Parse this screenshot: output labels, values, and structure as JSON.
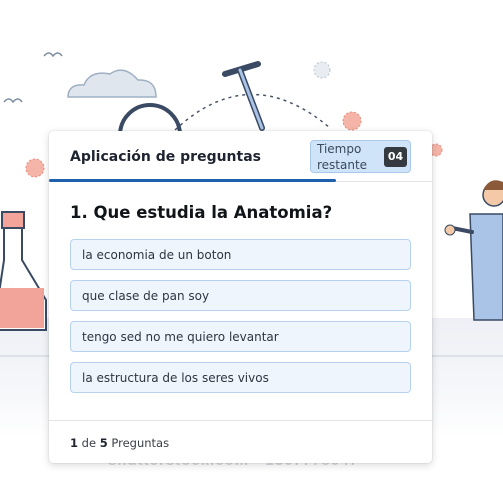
{
  "app": {
    "title": "Aplicación de preguntas",
    "timer_label": "Tiempo restante",
    "timer_value": "04",
    "time_progress_fraction": 0.75
  },
  "quiz": {
    "question": "1. Que estudia la Anatomia?",
    "options": [
      "la economia de un boton",
      "que clase de pan soy",
      "tengo sed no me quiero levantar",
      "la estructura de los seres vivos"
    ]
  },
  "footer": {
    "current": "1",
    "of_label": "de",
    "total": "5",
    "suffix": "Preguntas"
  },
  "background": {
    "watermark": "shutterstock.com · 1367778047"
  },
  "colors": {
    "accent": "#1e5fae",
    "timer_bg": "#cfe4f9",
    "option_bg": "#eef5fd",
    "option_border": "#b7d2ef"
  }
}
